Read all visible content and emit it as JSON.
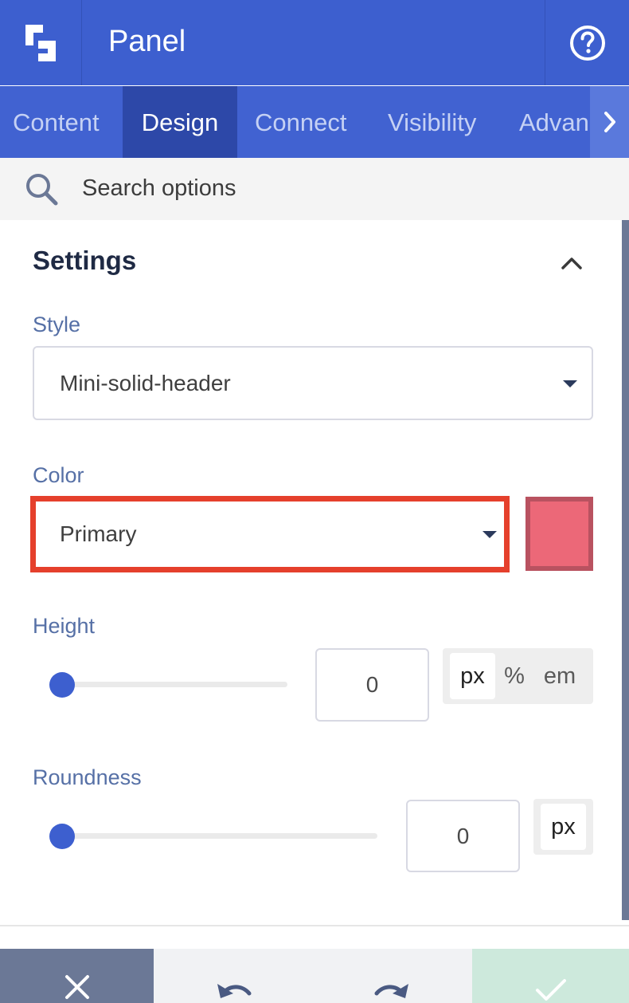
{
  "header": {
    "title": "Panel",
    "logo_icon": "builder-logo-icon",
    "help_icon": "help-circle-icon"
  },
  "tabs": [
    {
      "label": "Content",
      "active": false
    },
    {
      "label": "Design",
      "active": true
    },
    {
      "label": "Connect",
      "active": false
    },
    {
      "label": "Visibility",
      "active": false
    },
    {
      "label": "Advanced",
      "active": false
    }
  ],
  "search": {
    "placeholder": "Search options",
    "icon": "search-icon"
  },
  "settings": {
    "title": "Settings",
    "expanded": true,
    "style": {
      "label": "Style",
      "value": "Mini-solid-header"
    },
    "color": {
      "label": "Color",
      "value": "Primary",
      "swatch_color": "#ec6878",
      "highlighted": true,
      "highlight_color": "#e5402c"
    },
    "height": {
      "label": "Height",
      "value": "0",
      "slider_value": 0,
      "units": [
        "px",
        "%",
        "em"
      ],
      "active_unit": "px"
    },
    "roundness": {
      "label": "Roundness",
      "value": "0",
      "slider_value": 0,
      "units": [
        "px"
      ],
      "active_unit": "px"
    }
  },
  "footer": {
    "close_icon": "close-icon",
    "undo_icon": "undo-icon",
    "redo_icon": "redo-icon",
    "confirm_icon": "check-icon"
  },
  "colors": {
    "primary": "#3d5fcf",
    "tab_active": "#2d48a8",
    "label": "#5670a6",
    "confirm": "#cde9dc",
    "close": "#6b7896"
  }
}
